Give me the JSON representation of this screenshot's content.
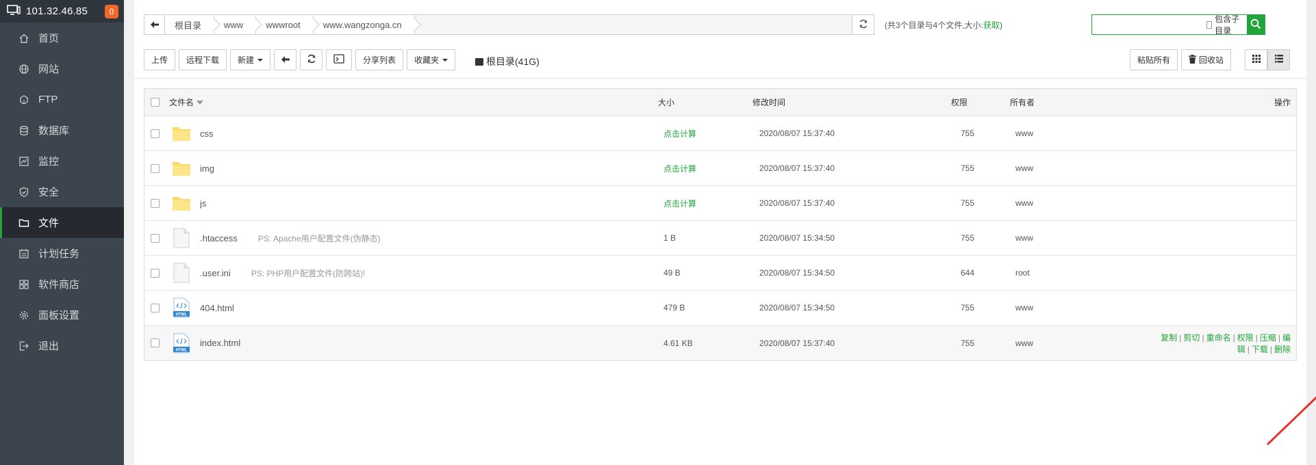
{
  "sidebar": {
    "server_ip": "101.32.46.85",
    "notice_count": "0",
    "items": [
      {
        "label": "首页",
        "icon": "home-icon"
      },
      {
        "label": "网站",
        "icon": "globe-icon"
      },
      {
        "label": "FTP",
        "icon": "ftp-icon"
      },
      {
        "label": "数据库",
        "icon": "database-icon"
      },
      {
        "label": "监控",
        "icon": "monitor-icon"
      },
      {
        "label": "安全",
        "icon": "shield-icon"
      },
      {
        "label": "文件",
        "icon": "folder-icon",
        "active": true
      },
      {
        "label": "计划任务",
        "icon": "calendar-icon"
      },
      {
        "label": "软件商店",
        "icon": "apps-icon"
      },
      {
        "label": "面板设置",
        "icon": "gear-icon"
      },
      {
        "label": "退出",
        "icon": "logout-icon"
      }
    ]
  },
  "path": {
    "crumbs": [
      "根目录",
      "www",
      "wwwroot",
      "www.wangzonga.cn"
    ],
    "info_text": "(共3个目录与4个文件,大小:",
    "info_link": "获取",
    "info_close": ")"
  },
  "search": {
    "placeholder": "",
    "include_subdirs_label": "包含子目录"
  },
  "toolbar": {
    "upload": "上传",
    "remote_download": "远程下载",
    "new": "新建",
    "share_list": "分享列表",
    "favorites": "收藏夹",
    "disk_label": "根目录(41G)",
    "paste_all": "粘贴所有",
    "recycle_bin": "回收站"
  },
  "table": {
    "headers": {
      "name": "文件名",
      "size": "大小",
      "modified": "修改时间",
      "permission": "权限",
      "owner": "所有者",
      "actions": "操作"
    },
    "rows": [
      {
        "name": "css",
        "type": "folder",
        "desc": "",
        "size": "点击计算",
        "modified": "2020/08/07 15:37:40",
        "perm": "755",
        "owner": "www"
      },
      {
        "name": "img",
        "type": "folder",
        "desc": "",
        "size": "点击计算",
        "modified": "2020/08/07 15:37:40",
        "perm": "755",
        "owner": "www"
      },
      {
        "name": "js",
        "type": "folder",
        "desc": "",
        "size": "点击计算",
        "modified": "2020/08/07 15:37:40",
        "perm": "755",
        "owner": "www"
      },
      {
        "name": ".htaccess",
        "type": "file",
        "desc": "PS: Apache用户配置文件(伪静态)",
        "size": "1 B",
        "modified": "2020/08/07 15:34:50",
        "perm": "755",
        "owner": "www"
      },
      {
        "name": ".user.ini",
        "type": "file",
        "desc": "PS: PHP用户配置文件(防跨站)!",
        "size": "49 B",
        "modified": "2020/08/07 15:34:50",
        "perm": "644",
        "owner": "root"
      },
      {
        "name": "404.html",
        "type": "html",
        "desc": "",
        "size": "479 B",
        "modified": "2020/08/07 15:34:50",
        "perm": "755",
        "owner": "www"
      },
      {
        "name": "index.html",
        "type": "html",
        "desc": "",
        "size": "4.61 KB",
        "modified": "2020/08/07 15:37:40",
        "perm": "755",
        "owner": "www"
      }
    ],
    "row_actions": [
      "复制",
      "剪切",
      "重命名",
      "权限",
      "压缩",
      "编辑",
      "下载",
      "删除"
    ]
  },
  "colors": {
    "accent": "#20a53a",
    "sidebar_bg": "#3c444d",
    "annotation_arrow": "#e8322c"
  }
}
